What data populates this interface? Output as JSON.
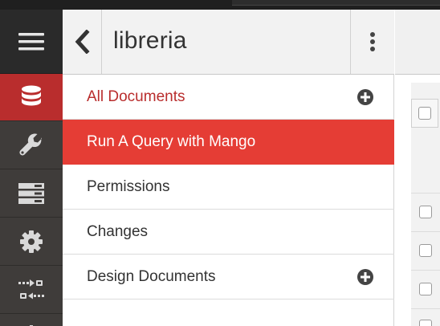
{
  "header": {
    "db_name": "libreria"
  },
  "sidebar": {
    "icons": [
      "menu-icon",
      "database-icon",
      "wrench-icon",
      "server-icon",
      "gear-icon",
      "replication-icon"
    ],
    "active_index": 1
  },
  "nav": {
    "items": [
      {
        "label": "All Documents",
        "has_add": true
      },
      {
        "label": "Run A Query with Mango",
        "has_add": false,
        "active": true
      },
      {
        "label": "Permissions",
        "has_add": false
      },
      {
        "label": "Changes",
        "has_add": false
      },
      {
        "label": "Design Documents",
        "has_add": true
      }
    ]
  },
  "colors": {
    "accent": "#e53d35",
    "accent_dark": "#b92d2d",
    "rail": "#3f3c3a"
  }
}
